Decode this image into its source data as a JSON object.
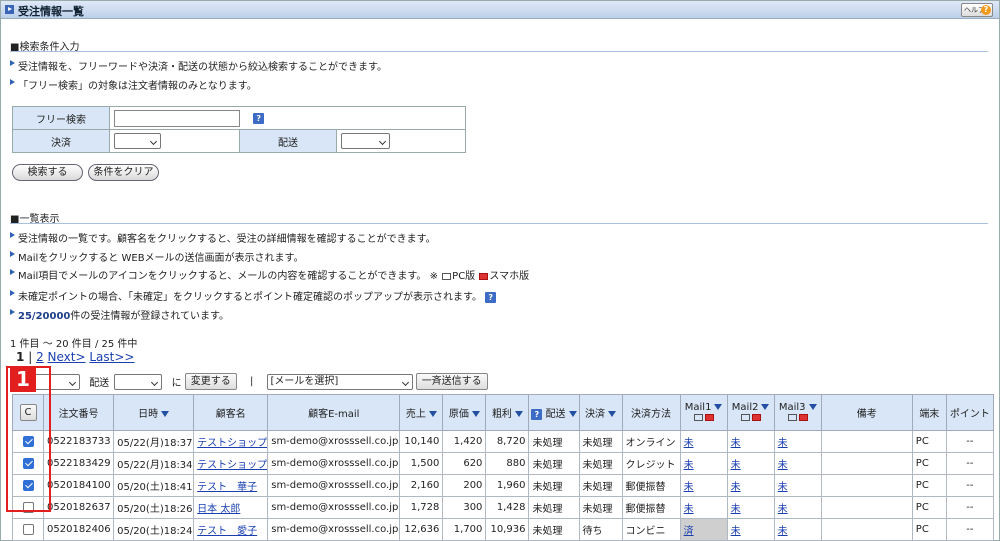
{
  "window": {
    "title": "受注情報一覧",
    "help_label": "ヘルプ"
  },
  "search": {
    "section_title": "■検索条件入力",
    "notes": [
      "受注情報を、フリーワードや決済・配送の状態から絞込検索することができます。",
      "「フリー検索」の対象は注文者情報のみとなります。"
    ],
    "free_label": "フリー検索",
    "payment_label": "決済",
    "delivery_label": "配送",
    "search_button": "検索する",
    "clear_button": "条件をクリア"
  },
  "list": {
    "section_title": "■一覧表示",
    "notes": [
      "受注情報の一覧です。顧客名をクリックすると、受注の詳細情報を確認することができます。",
      "Mailをクリックすると WEBメールの送信画面が表示されます。",
      "Mail項目でメールのアイコンをクリックすると、メールの内容を確認することができます。 ※",
      "未確定ポイントの場合、「未確定」をクリックするとポイント確定確認のポップアップが表示されます。"
    ],
    "pc_label": "PC版",
    "sp_label": "スマホ版",
    "count_total": "25/20000",
    "count_suffix": "件の受注情報が登録されています。",
    "range_text": "1 件目 ～ 20 件目 / 25 件中",
    "pager": {
      "current": "1",
      "sep": "|",
      "page2": "2",
      "next": "Next>",
      "last": "Last>>"
    }
  },
  "bulk": {
    "delivery_label": "配送",
    "ni": "に",
    "change_button": "変更する",
    "sep": "|",
    "mail_select": "[メールを選択]",
    "send_button": "一斉送信する"
  },
  "table": {
    "check_all": "C",
    "headers": {
      "order_no": "注文番号",
      "date": "日時",
      "customer": "顧客名",
      "email": "顧客E-mail",
      "sales": "売上",
      "cost": "原価",
      "profit": "粗利",
      "delivery": "配送",
      "payment": "決済",
      "method": "決済方法",
      "mail1": "Mail1",
      "mail2": "Mail2",
      "mail3": "Mail3",
      "remarks": "備考",
      "device": "端末",
      "points": "ポイント"
    },
    "rows": [
      {
        "checked": true,
        "order_no": "0522183733",
        "date": "05/22(月)18:37",
        "customer": "テストショップ",
        "email": "sm-demo@xrosssell.co.jp",
        "sales": "10,140",
        "cost": "1,420",
        "profit": "8,720",
        "delivery": "未処理",
        "payment": "未処理",
        "method": "オンライン",
        "mail1": "未",
        "mail2": "未",
        "mail3": "未",
        "remarks": "",
        "device": "PC",
        "points": "--"
      },
      {
        "checked": true,
        "order_no": "0522183429",
        "date": "05/22(月)18:34",
        "customer": "テストショップ",
        "email": "sm-demo@xrosssell.co.jp",
        "sales": "1,500",
        "cost": "620",
        "profit": "880",
        "delivery": "未処理",
        "payment": "未処理",
        "method": "クレジット",
        "mail1": "未",
        "mail2": "未",
        "mail3": "未",
        "remarks": "",
        "device": "PC",
        "points": "--"
      },
      {
        "checked": true,
        "order_no": "0520184100",
        "date": "05/20(土)18:41",
        "customer": "テスト　華子",
        "email": "sm-demo@xrosssell.co.jp",
        "sales": "2,160",
        "cost": "200",
        "profit": "1,960",
        "delivery": "未処理",
        "payment": "未処理",
        "method": "郵便振替",
        "mail1": "未",
        "mail2": "未",
        "mail3": "未",
        "remarks": "",
        "device": "PC",
        "points": "--"
      },
      {
        "checked": false,
        "order_no": "0520182637",
        "date": "05/20(土)18:26",
        "customer": "日本 太郎",
        "email": "sm-demo@xrosssell.co.jp",
        "sales": "1,728",
        "cost": "300",
        "profit": "1,428",
        "delivery": "未処理",
        "payment": "未処理",
        "method": "郵便振替",
        "mail1": "未",
        "mail2": "未",
        "mail3": "未",
        "remarks": "",
        "device": "PC",
        "points": "--"
      },
      {
        "checked": false,
        "order_no": "0520182406",
        "date": "05/20(土)18:24",
        "customer": "テスト　愛子",
        "email": "sm-demo@xrosssell.co.jp",
        "sales": "12,636",
        "cost": "1,700",
        "profit": "10,936",
        "delivery": "未処理",
        "payment": "待ち",
        "method": "コンビニ",
        "mail1": "済",
        "mail2": "未",
        "mail3": "未",
        "remarks": "",
        "device": "PC",
        "points": "--"
      }
    ]
  },
  "annotation": {
    "badge": "1"
  }
}
